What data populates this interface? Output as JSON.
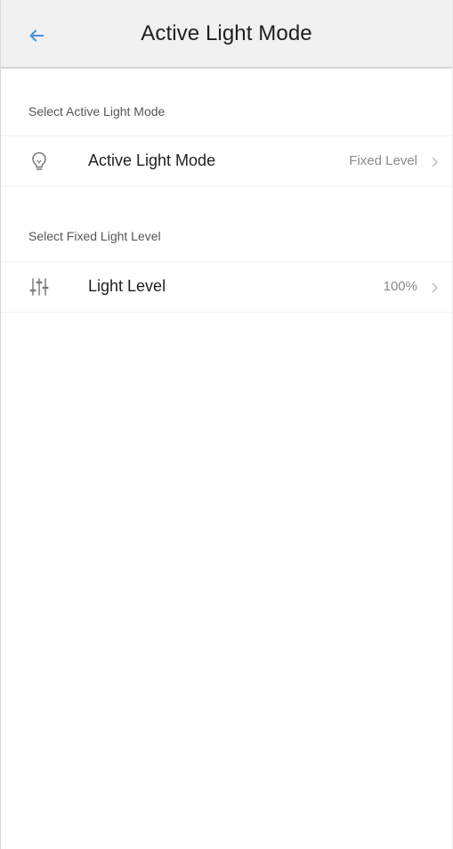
{
  "header": {
    "title": "Active Light Mode",
    "back_icon": "arrow-left-icon"
  },
  "sections": [
    {
      "header": "Select Active Light Mode",
      "row": {
        "icon": "lightbulb-icon",
        "label": "Active Light Mode",
        "value": "Fixed Level",
        "chevron_icon": "chevron-right-icon"
      }
    },
    {
      "header": "Select Fixed Light Level",
      "row": {
        "icon": "sliders-icon",
        "label": "Light Level",
        "value": "100%",
        "chevron_icon": "chevron-right-icon"
      }
    }
  ],
  "colors": {
    "accent": "#4a90d9",
    "appbar_background": "#f1f1f1",
    "secondary_text": "#8a8a8a"
  }
}
